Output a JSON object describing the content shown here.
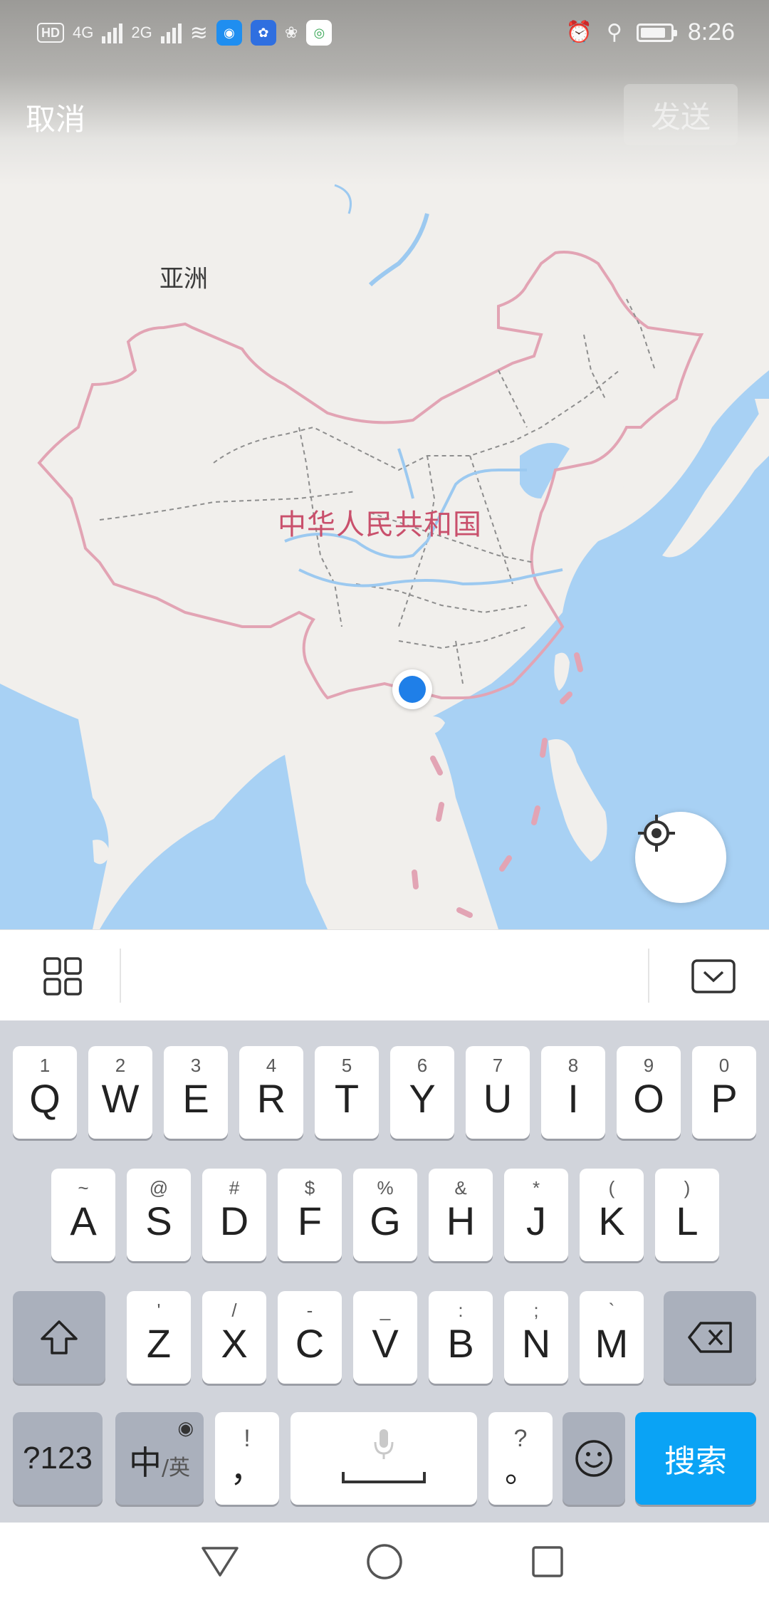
{
  "status_bar": {
    "hd_badge": "HD",
    "sim1_label": "4G",
    "sim2_label": "2G",
    "time": "8:26",
    "battery_level": 0.85
  },
  "header": {
    "cancel_label": "取消",
    "send_label": "发送"
  },
  "map": {
    "continent_label": "亚洲",
    "country_label": "中华人民共和国",
    "colors": {
      "land": "#f1efec",
      "water": "#a8d1f4",
      "border": "#e2a4b4",
      "province": "#8e8e8e",
      "river": "#9cc9f0",
      "location": "#1f7fe8"
    }
  },
  "keyboard": {
    "rows": [
      [
        {
          "main": "Q",
          "sup": "1"
        },
        {
          "main": "W",
          "sup": "2"
        },
        {
          "main": "E",
          "sup": "3"
        },
        {
          "main": "R",
          "sup": "4"
        },
        {
          "main": "T",
          "sup": "5"
        },
        {
          "main": "Y",
          "sup": "6"
        },
        {
          "main": "U",
          "sup": "7"
        },
        {
          "main": "I",
          "sup": "8"
        },
        {
          "main": "O",
          "sup": "9"
        },
        {
          "main": "P",
          "sup": "0"
        }
      ],
      [
        {
          "main": "A",
          "sup": "~"
        },
        {
          "main": "S",
          "sup": "@"
        },
        {
          "main": "D",
          "sup": "#"
        },
        {
          "main": "F",
          "sup": "$"
        },
        {
          "main": "G",
          "sup": "%"
        },
        {
          "main": "H",
          "sup": "&"
        },
        {
          "main": "J",
          "sup": "*"
        },
        {
          "main": "K",
          "sup": "("
        },
        {
          "main": "L",
          "sup": ")"
        }
      ],
      [
        {
          "main": "Z",
          "sup": "'"
        },
        {
          "main": "X",
          "sup": "/"
        },
        {
          "main": "C",
          "sup": "-"
        },
        {
          "main": "V",
          "sup": "_"
        },
        {
          "main": "B",
          "sup": ":"
        },
        {
          "main": "N",
          "sup": ";"
        },
        {
          "main": "M",
          "sup": "`"
        }
      ]
    ],
    "numbers_key": "?123",
    "lang_key_main": "中",
    "lang_key_sub": "/英",
    "comma_key_main": "，",
    "comma_key_sup": "!",
    "period_key_main": "。",
    "period_key_sup": "?",
    "search_key": "搜索",
    "search_key_color": "#0aa3f5"
  }
}
